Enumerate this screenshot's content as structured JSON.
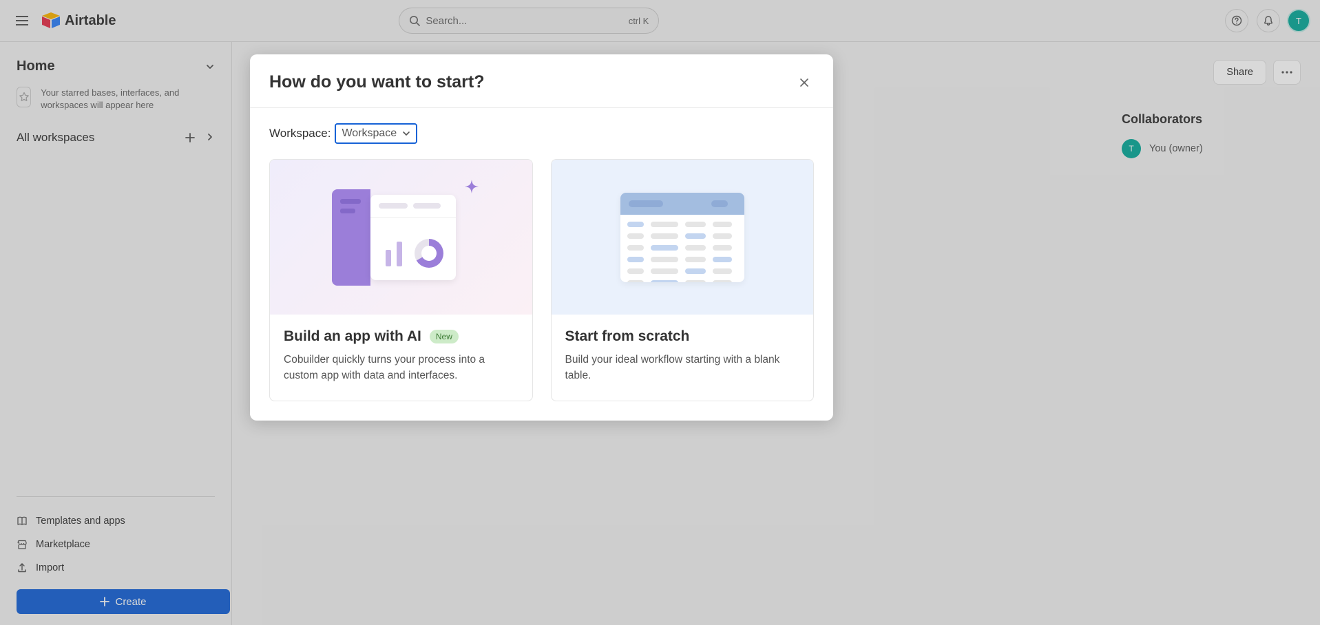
{
  "header": {
    "brand": "Airtable",
    "search_placeholder": "Search...",
    "search_shortcut": "ctrl K",
    "avatar_initial": "T"
  },
  "sidebar": {
    "home": "Home",
    "starred_hint": "Your starred bases, interfaces, and workspaces will appear here",
    "all_workspaces": "All workspaces",
    "links": {
      "templates": "Templates and apps",
      "marketplace": "Marketplace",
      "import": "Import"
    },
    "create": "Create"
  },
  "topActions": {
    "share": "Share"
  },
  "collaborators": {
    "title": "Collaborators",
    "items": [
      {
        "initial": "T",
        "label": "You (owner)"
      }
    ]
  },
  "modal": {
    "title": "How do you want to start?",
    "workspace_label": "Workspace:",
    "workspace_value": "Workspace",
    "cards": [
      {
        "title": "Build an app with AI",
        "badge": "New",
        "desc": "Cobuilder quickly turns your process into a custom app with data and interfaces."
      },
      {
        "title": "Start from scratch",
        "desc": "Build your ideal workflow starting with a blank table."
      }
    ]
  }
}
